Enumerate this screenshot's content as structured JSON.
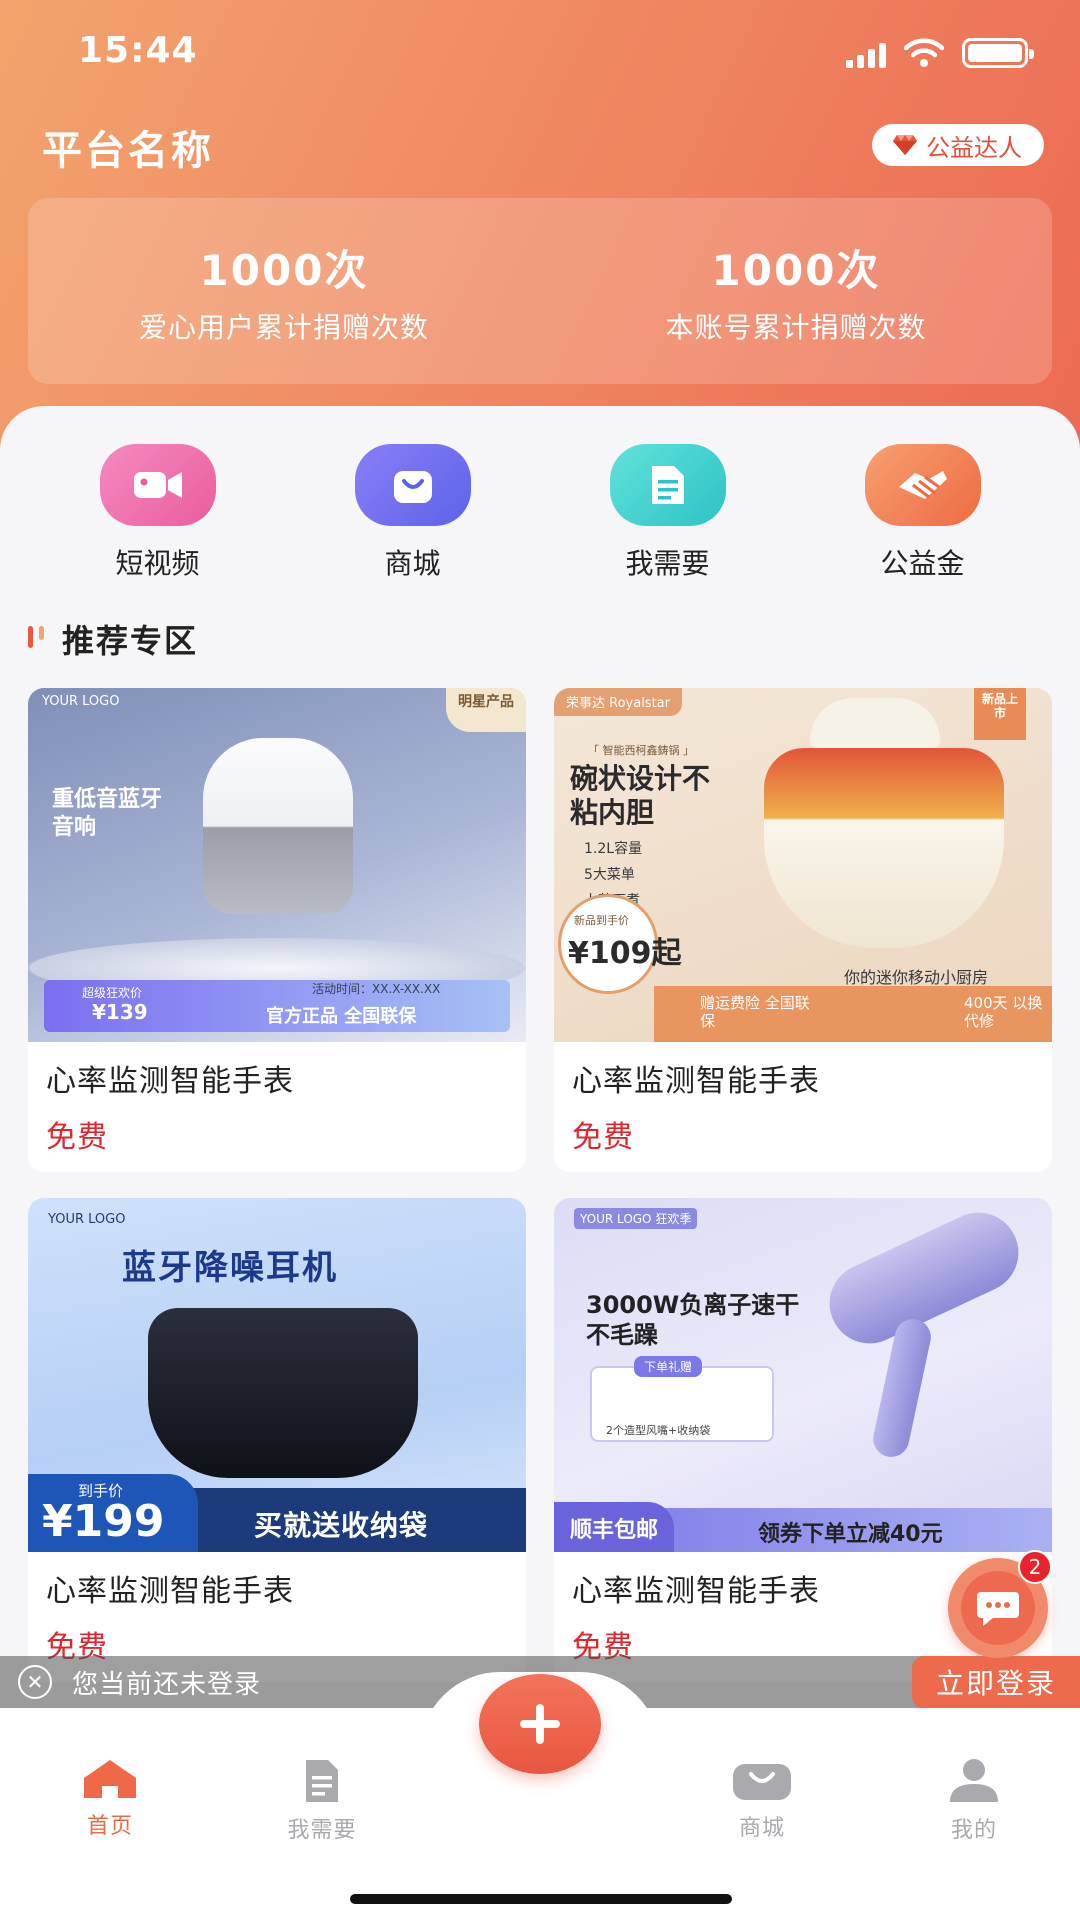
{
  "status_bar": {
    "time": "15:44"
  },
  "header": {
    "title": "平台名称",
    "badge_label": "公益达人",
    "stats": [
      {
        "value": "1000次",
        "label": "爱心用户累计捐赠次数"
      },
      {
        "value": "1000次",
        "label": "本账号累计捐赠次数"
      }
    ]
  },
  "quick_menu": [
    {
      "label": "短视频",
      "icon": "video-camera-icon",
      "color": "#ef6fae"
    },
    {
      "label": "商城",
      "icon": "shopping-bag-icon",
      "color": "#6b6ff0"
    },
    {
      "label": "我需要",
      "icon": "document-icon",
      "color": "#3fd2cf"
    },
    {
      "label": "公益金",
      "icon": "handshake-icon",
      "color": "#f17a4f"
    }
  ],
  "section": {
    "title": "推荐专区"
  },
  "products": [
    {
      "name": "心率监测智能手表",
      "price": "免费",
      "image": {
        "logo": "YOUR LOGO",
        "tag": "明星产品",
        "headline": "重低音蓝牙音响",
        "promo_label": "超级狂欢价",
        "promo_price": "¥139",
        "time_text": "活动时间：XX.X-XX.XX",
        "banner": "官方正品 全国联保"
      }
    },
    {
      "name": "心率监测智能手表",
      "price": "免费",
      "image": {
        "logo": "荣事达 Royalstar",
        "tag": "新品上市",
        "subtitle": "「 智能西柯鑫鋳锅 」",
        "headline": "碗状设计不粘内胆",
        "features": [
          "1.2L容量",
          "5大菜单",
          "上蒸下煮"
        ],
        "price_label": "新品到手价",
        "price": "¥109起",
        "slogan": "你的迷你移动小厨房",
        "perk1": "赠运费险 全国联保",
        "perk2": "400天 以换代修"
      }
    },
    {
      "name": "心率监测智能手表",
      "price": "免费",
      "image": {
        "logo": "YOUR LOGO",
        "headline": "蓝牙降噪耳机",
        "price_label": "到手价",
        "price": "¥199",
        "banner": "买就送收纳袋"
      }
    },
    {
      "name": "心率监测智能手表",
      "price": "免费",
      "image": {
        "logo": "YOUR LOGO 狂欢季",
        "headline": "3000W负离子速干不毛躁",
        "gift_label": "下单礼赠",
        "gift_text": "2个造型风嘴+收纳袋",
        "shipping": "顺丰包邮",
        "coupon": "领券下单立减40元"
      }
    }
  ],
  "login_bar": {
    "text": "您当前还未登录",
    "button": "立即登录"
  },
  "chat": {
    "badge_count": "2"
  },
  "tabbar": [
    {
      "label": "首页",
      "icon": "home-icon",
      "active": true
    },
    {
      "label": "我需要",
      "icon": "document-icon",
      "active": false
    },
    {
      "label": "商城",
      "icon": "shopping-bag-icon",
      "active": false
    },
    {
      "label": "我的",
      "icon": "user-icon",
      "active": false
    }
  ],
  "colors": {
    "accent": "#ec6a52",
    "price": "#e0262c",
    "tab_active": "#ef6848",
    "tab_inactive": "#a9a9ae"
  }
}
